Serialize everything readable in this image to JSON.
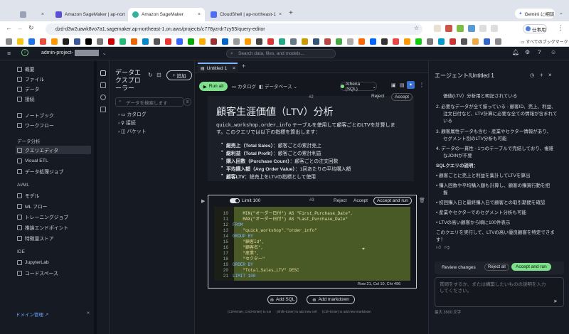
{
  "browser": {
    "tabs": [
      {
        "label": "",
        "active": false
      },
      {
        "label": "Amazon SageMaker | ap-nort",
        "active": false
      },
      {
        "label": "Amazon SageMaker",
        "active": true
      },
      {
        "label": "CloudShell | ap-northeast-1",
        "active": false
      }
    ],
    "gemini_label": "Gemini に相談",
    "url": "dzd-d3w2uawk8vo7a1.sagemaker.ap-northeast-1.on.aws/projects/c778yzrdr7zy55/query-editor",
    "profile_label": "仕事用",
    "bookmarks_label": "すべてのブックマーク"
  },
  "topbar": {
    "project": "admin-project-",
    "search_placeholder": "Search data, files, and models..."
  },
  "sidebar": {
    "items": [
      {
        "label": "概要"
      },
      {
        "label": "ファイル"
      },
      {
        "label": "データ"
      },
      {
        "label": "接続"
      },
      {
        "label": "ノートブック"
      },
      {
        "label": "ワークフロー"
      }
    ],
    "section_analysis": "データ分析",
    "analysis_items": [
      {
        "label": "クエリエディタ"
      },
      {
        "label": "Visual ETL"
      },
      {
        "label": "データ処理ジョブ"
      }
    ],
    "section_aiml": "AI/ML",
    "aiml_items": [
      {
        "label": "モデル"
      },
      {
        "label": "ML フロー"
      },
      {
        "label": "トレーニングジョブ"
      },
      {
        "label": "推論エンドポイント"
      },
      {
        "label": "特徴量ストア"
      }
    ],
    "section_ide": "IDE",
    "ide_items": [
      {
        "label": "JupyterLab"
      },
      {
        "label": "コードスペース"
      }
    ],
    "domain_admin": "ドメイン管理"
  },
  "explorer": {
    "title": "データエクスプローラー",
    "add_label": "追加",
    "search_placeholder": "データを検索します",
    "tree": [
      {
        "label": "カタログ"
      },
      {
        "label": "接続"
      },
      {
        "label": "バケット"
      }
    ]
  },
  "editor": {
    "tab_label": "Untitled 1",
    "run_all": "Run all",
    "catalog": "カタログ",
    "database": "データベース",
    "engine": "Athena (SQL)",
    "cell2": {
      "number": "#2",
      "reject": "Reject",
      "accept": "Accept",
      "heading": "顧客生涯価値（LTV）分析",
      "intro_code": "quick_workshop.order_info",
      "intro_rest": "テーブルを使用して顧客ごとのLTVを計算しま",
      "intro_line2": "す。このクエリでは以下の指標を算出します：",
      "bullets": [
        {
          "bold": "総売上（Total Sales）",
          "text": "：顧客ごとの累計売上"
        },
        {
          "bold": "総利益（Total Profit）",
          "text": "：顧客ごとの累計利益"
        },
        {
          "bold": "購入回数（Purchase Count）",
          "text": "：顧客ごとの注文回数"
        },
        {
          "bold": "平均購入額（Avg Order Value）",
          "text": "：1回あたりの平均購入額"
        },
        {
          "bold": "顧客LTV",
          "text": "：総売上をLTVの指標として使用"
        }
      ]
    },
    "cell3": {
      "limit": "Limit 100",
      "number": "#3",
      "reject": "Reject",
      "accept": "Accept",
      "accept_run": "Accept and run",
      "status": "Row 21, Col 10, Chr 496",
      "lines": [
        {
          "n": "10",
          "code": "    MIN(\"オーダー日付\") AS \"First_Purchase_Date\","
        },
        {
          "n": "11",
          "code": "    MAX(\"オーダー日付\") AS \"Last_Purchase_Date\""
        },
        {
          "n": "12",
          "code": "FROM"
        },
        {
          "n": "13",
          "code": "    \"quick_workshop\".\"order_info\""
        },
        {
          "n": "14",
          "code": "GROUP BY"
        },
        {
          "n": "15",
          "code": "    \"顧客Id\","
        },
        {
          "n": "16",
          "code": "    \"顧客名\","
        },
        {
          "n": "17",
          "code": "    \"産業\","
        },
        {
          "n": "18",
          "code": "    \"セクター\""
        },
        {
          "n": "19",
          "code": "ORDER BY"
        },
        {
          "n": "20",
          "code": "    \"Total_Sales_LTV\" DESC"
        },
        {
          "n": "21",
          "code": "LIMIT 100"
        }
      ]
    },
    "add_sql": "Add SQL",
    "add_markdown": "Add markdown",
    "hint": "(Ctrl+Enter, Cmd+Enter) to run      (Shift+Enter) to add new cell      (Ctrl+Enter) to add new markdown"
  },
  "agent": {
    "title": "エージェント/Untitled 1",
    "lines": [
      "価値(LTV）分析用と明記されている",
      "必要なデータが全て揃っている - 顧客ID、売上、利益、",
      "注文日付など、LTV計算に必要な全ての情報が含まれて",
      "いる",
      "顧客属性データも含む - 産業やセクター情報があり、",
      "セグメント別のLTV分析も可能",
      "データの一貫性 - 1つのテーブルで完結しており、複雑",
      "なJOINが不要",
      "SQLクエリの説明：",
      "顧客ごとに売上と利益を集計してLTVを算出",
      "購入回数や平均購入額も計算し、顧客の購買行動を把",
      "握",
      "初回購入日と最終購入日で顧客との取引期間を確認",
      "産業やセクターでのセグメント分析も可能",
      "LTVの高い顧客から順に100件表示",
      "このクエリを実行して、LTVの高い優良顧客を特定できま",
      "す！"
    ],
    "review_changes": "Review changes",
    "reject_all": "Reject all",
    "accept_and_run": "Accept and run",
    "input_placeholder": "質問をするか、または構築したいものの説明を入力してください。",
    "char_limit": "最大 3500 文字"
  },
  "colors": {
    "accent": "#7ee08a",
    "highlight": "#4a5a26"
  }
}
